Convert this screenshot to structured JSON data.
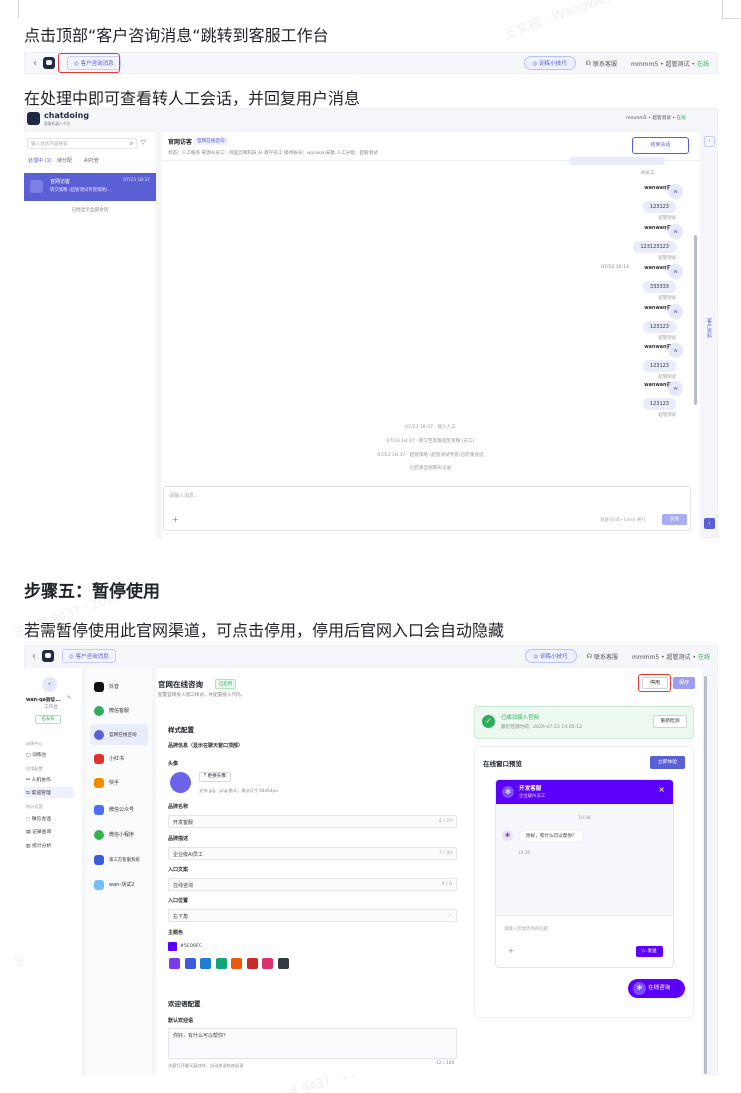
{
  "doc": {
    "heading_1": "点击顶部“客户咨询消息“跳转到客服工作台",
    "heading_2": "在处理中即可查看转人工会话，并回复用户消息",
    "step_title": "步骤五：暂停使用",
    "heading_3": "若需暂停使用此官网渠道，可点击停用，停用后官网入口会自动隐藏",
    "watermark_top": "王文福 · WangWenQi",
    "watermark_mid": "王文福 9437 · 2026-7-23"
  },
  "shot1": {
    "back": "‹",
    "consult_btn": "客户咨询消息",
    "tips_btn": "训练小技巧",
    "contact": "联系客服",
    "user": "mmmm5 • 超管测试 •",
    "online": "在线"
  },
  "shot2": {
    "brand": "chatdoing",
    "brand_sub": "客服机器人平台",
    "search_placeholder": "输入会话内容搜索",
    "tabs": [
      "处理中 (1)",
      "待分配",
      "AI托管"
    ],
    "session_name": "官网访客",
    "session_time": "07/23 18:37",
    "session_preview": "转交策略 (超管测试专管策略)...",
    "no_more": "已经显示全部会话",
    "header_title": "官网访客",
    "header_badge": "官网在线咨询",
    "header_status": "状态：人工服务   来源AI员工：阿里云啊科技 AI 教学员工   接待账号：wanwan安勤   人工分组：超管测试",
    "end_btn": "结束会话",
    "top_user": "mmmm5 • 超管测试 •",
    "online": "在线",
    "ai_agent": "AI员工",
    "messages": [
      {
        "name": "wanwan安勤",
        "text": "123123",
        "meta": "超管测试"
      },
      {
        "name": "wanwan安勤",
        "text": "123123123",
        "meta": "超管测试"
      },
      {
        "time": "07/22 16:14",
        "name": "wanwan安勤",
        "text": "333333",
        "meta": "超管测试"
      },
      {
        "name": "wanwan安勤",
        "text": "123123",
        "meta": "超管测试"
      },
      {
        "name": "wanwan安勤",
        "text": "123123",
        "meta": "超管测试"
      },
      {
        "name": "wanwan安勤",
        "text": "123123",
        "meta": "超管测试"
      }
    ],
    "avatar_letter": "w",
    "system": [
      "07/23 18:37  · 接入人工",
      "07/23 18:37  · 转交至客服组至策略 (员工)",
      "07/23 18:37  · 超管策略 (超管测试专管)已结束会话"
    ],
    "ended": "已结束全部聊天记录",
    "input_placeholder": "请输入消息...",
    "send_hint": "发送 Shift+Enter 换行",
    "send_btn": "发送",
    "side_tab": "客户资料"
  },
  "shot3": {
    "consult_btn": "客户咨询消息",
    "tips_btn": "训练小技巧",
    "contact": "联系客服",
    "user": "mmmm5 • 超管测试 •",
    "online": "在线",
    "agent_name": "wan-qa验证...",
    "agent_sub": "工作台",
    "published": "已发布",
    "side_groups": [
      "训练中心",
      "应用配置",
      "统计运营"
    ],
    "side_items": [
      "训练台",
      "人机协作",
      "渠道管理",
      "微信会话",
      "记录查询",
      "统计分析"
    ],
    "channels": [
      "抖音",
      "微信客服",
      "官网在线咨询",
      "小红书",
      "快手",
      "微信公众号",
      "微信小程序",
      "第三方客服系统",
      "wan-测试2"
    ],
    "title": "官网在线咨询",
    "title_badge": "已启用",
    "subtitle": "配置官网接入窗口样式，并配置接入代码。",
    "stop_btn": "停用",
    "save_btn": "保存",
    "style_config": "样式配置",
    "brand_info": "品牌信息（显示在聊天窗口顶部）",
    "avatar_label": "头像",
    "upload_btn": "更换头像",
    "upload_hint": "支持 jpg、png 格式，建议尺寸 64x64px",
    "brand_name_label": "品牌名称",
    "brand_name": "开发客服",
    "brand_name_count": "4 / 20",
    "brand_desc_label": "品牌描述",
    "brand_desc": "企业级AI员工",
    "brand_desc_count": "7 / 30",
    "entry_text_label": "入口文案",
    "entry_text": "在线咨询",
    "entry_text_count": "4 / 8",
    "entry_pos_label": "入口位置",
    "entry_pos": "右下角",
    "theme_label": "主题色",
    "theme_hex": "#5C00FC",
    "swatch_colors": [
      "#7c3aed",
      "#3b5bdb",
      "#1c7ed6",
      "#0ca678",
      "#e8590c",
      "#c92a2a",
      "#d6336c",
      "#343a40"
    ],
    "welcome_config": "欢迎语配置",
    "welcome_label": "默认欢迎语",
    "welcome_text": "你好，有什么可以帮你？",
    "welcome_hint": "访客打开聊天窗口时，自动发送的欢迎语",
    "welcome_count": "12 / 100",
    "connected_title": "已成功接入官网",
    "connected_sub": "最近检测时间：2026-07-23 14:05:12",
    "recheck_btn": "重新检测",
    "preview_title": "在线窗口预览",
    "preview_btn": "立即体验",
    "chat_name": "开发客服",
    "chat_sub": "企业级AI员工",
    "chat_close": "×",
    "chat_time": "10:36",
    "chat_msg": "你好，有什么可以帮你？",
    "chat_msg_time": "10:36",
    "chat_input": "请输入您想咨询的问题",
    "chat_plus": "+",
    "chat_send": "发送",
    "float_btn": "在线咨询"
  }
}
